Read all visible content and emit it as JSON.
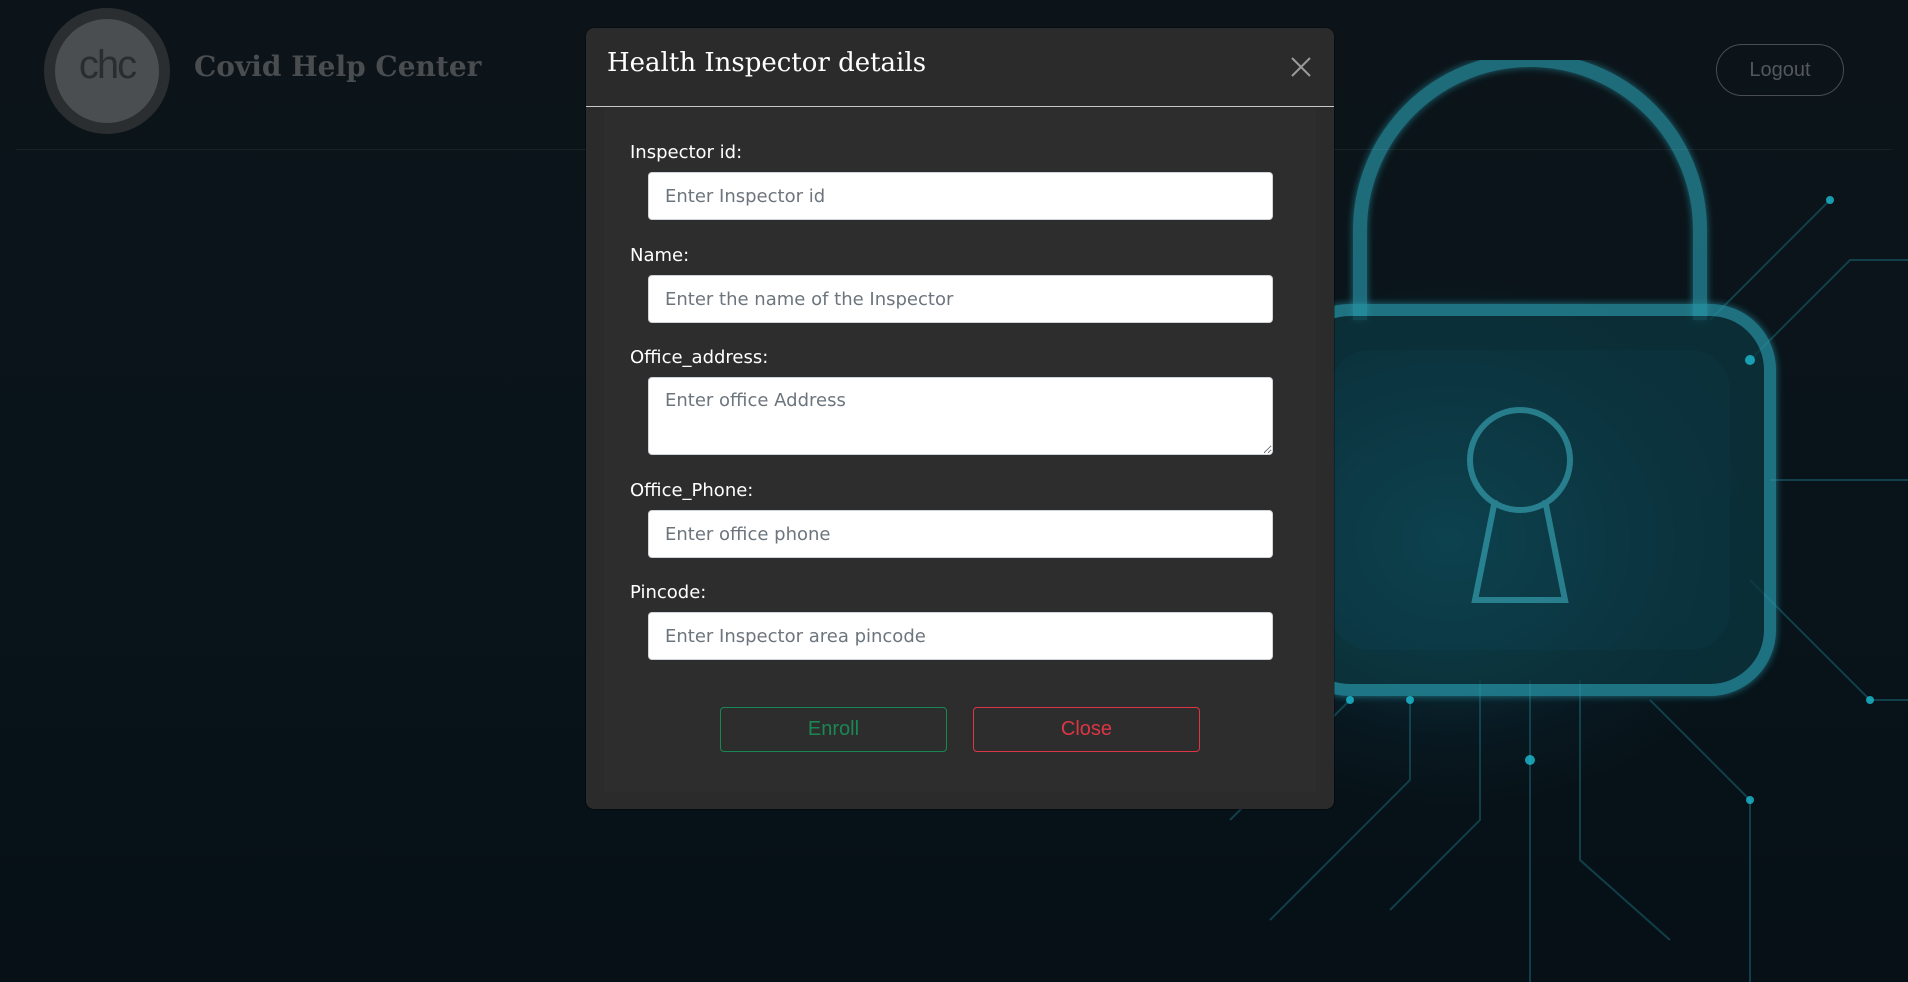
{
  "navbar": {
    "logo_text": "chc",
    "brand": "Covid Help Center",
    "logout_label": "Logout"
  },
  "modal": {
    "title": "Health Inspector details",
    "fields": [
      {
        "label": "Inspector id:",
        "placeholder": "Enter Inspector id",
        "value": ""
      },
      {
        "label": "Name:",
        "placeholder": "Enter the name of the Inspector",
        "value": ""
      },
      {
        "label": "Office_address:",
        "placeholder": "Enter office Address",
        "value": ""
      },
      {
        "label": "Office_Phone:",
        "placeholder": "Enter office phone",
        "value": ""
      },
      {
        "label": "Pincode:",
        "placeholder": "Enter Inspector area pincode",
        "value": ""
      }
    ],
    "enroll_label": "Enroll",
    "close_label": "Close"
  },
  "colors": {
    "enroll": "#198754",
    "close": "#dc3545",
    "modal_bg": "#2b2b2b",
    "accent_glow": "#1fa3b8"
  },
  "icons": {
    "modal_close": "close-icon",
    "background": "padlock-icon"
  }
}
